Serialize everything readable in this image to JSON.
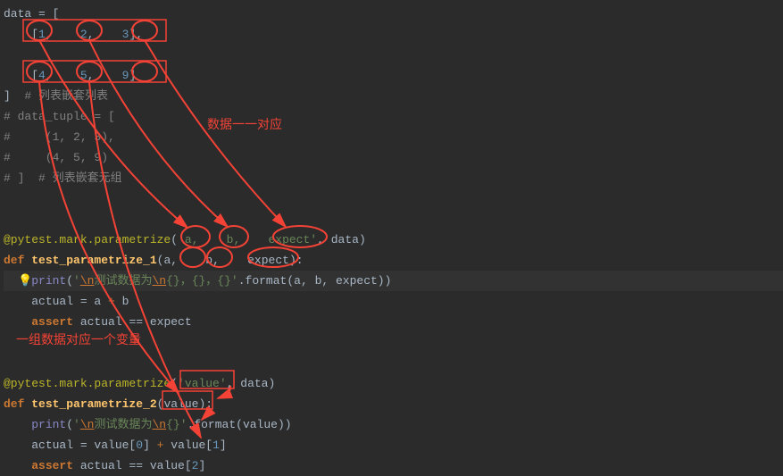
{
  "lines": {
    "l1a": "data",
    "l1b": " = [",
    "l2_1": "1",
    "l2_2": "2",
    "l2_3": "3",
    "l4_1": "4",
    "l4_2": "5",
    "l4_3": "9",
    "l5_comment": "  # 列表嵌套列表",
    "l6": "# data_tuple = [",
    "l7": "#     (1, 2, 3),",
    "l8": "#     (4, 5, 9)",
    "l9": "# ]  # 列表嵌套元组",
    "l11_deco": "@pytest.mark.parametrize",
    "l11_str_a": "a,    b,    expect",
    "l11_data": "data",
    "l12_def": "def",
    "l12_name": "test_parametrize_1",
    "l12_pa": "a",
    "l12_pb": "b",
    "l12_pe": "expect",
    "l13_str1": "'",
    "l13_esc1": "\\n",
    "l13_txt": "测试数据为",
    "l13_esc2": "\\n",
    "l13_str2": "{}，{}，{}'",
    "l13_fmt": "format",
    "l13_a": "a",
    "l13_b": "b",
    "l13_e": "expect",
    "l14_actual": "actual = a ",
    "l14_plus": "+",
    "l14_b": " b",
    "l15_assert": "assert",
    "l15_rest": " actual == expect",
    "l17_deco": "@pytest.mark.parametrize",
    "l17_str": "'value'",
    "l17_data": "data",
    "l18_def": "def",
    "l18_name": "test_parametrize_2",
    "l18_p": "value",
    "l19_str1": "'",
    "l19_esc1": "\\n",
    "l19_txt": "测试数据为",
    "l19_esc2": "\\n",
    "l19_str2": "{}'",
    "l19_fmt": "format",
    "l19_val": "value",
    "l20_a": "actual = value[",
    "l20_n0": "0",
    "l20_b": "] ",
    "l20_plus": "+",
    "l20_c": " value[",
    "l20_n1": "1",
    "l20_d": "]",
    "l21_assert": "assert",
    "l21_a": " actual == value[",
    "l21_n2": "2",
    "l21_b": "]"
  },
  "annotations": {
    "label_top": "数据一一对应",
    "label_mid": "一组数据对应一个变量"
  },
  "chart_data": {
    "type": "table",
    "note": "Code screenshot — no chart plotted. Data values from code sample.",
    "data_list": [
      [
        1,
        2,
        3
      ],
      [
        4,
        5,
        9
      ]
    ]
  }
}
